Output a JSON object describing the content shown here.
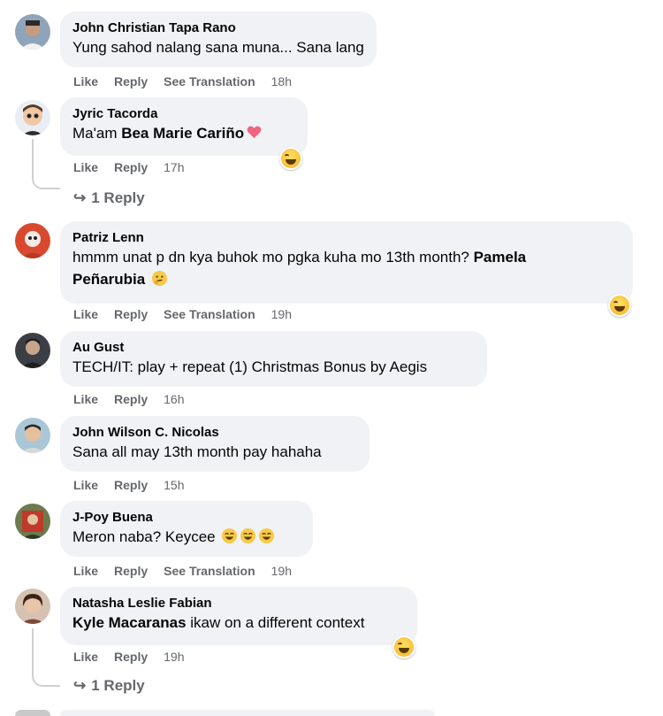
{
  "comments": [
    {
      "author": "John Christian Tapa Rano",
      "text": "Yung sahod nalang sana muna... Sana lang",
      "like": "Like",
      "reply": "Reply",
      "translate": "See Translation",
      "time": "18h"
    },
    {
      "author": "Jyric Tacorda",
      "prefix": "Ma'am ",
      "mention": "Bea Marie Cariño",
      "like": "Like",
      "reply": "Reply",
      "time": "17h",
      "replies": "1 Reply"
    },
    {
      "author": "Patriz Lenn",
      "text1": "hmmm unat p dn kya buhok mo pgka kuha mo 13th month? ",
      "mention_a": "Pamela",
      "mention_b": "Peñarubia",
      "like": "Like",
      "reply": "Reply",
      "translate": "See Translation",
      "time": "19h"
    },
    {
      "author": "Au Gust",
      "text": "TECH/IT: play + repeat (1) Christmas Bonus by Aegis",
      "like": "Like",
      "reply": "Reply",
      "time": "16h"
    },
    {
      "author": "John Wilson C. Nicolas",
      "text": "Sana all may 13th month pay hahaha",
      "like": "Like",
      "reply": "Reply",
      "time": "15h"
    },
    {
      "author": "J-Poy Buena",
      "text": "Meron naba? Keycee ",
      "like": "Like",
      "reply": "Reply",
      "translate": "See Translation",
      "time": "19h"
    },
    {
      "author": "Natasha Leslie Fabian",
      "mention": "Kyle Macaranas",
      "text": " ikaw on a different context",
      "like": "Like",
      "reply": "Reply",
      "time": "19h",
      "replies": "1 Reply"
    }
  ],
  "colors": {
    "bubble": "#f0f2f5",
    "meta": "#65676b",
    "text": "#050505"
  },
  "icons": [
    "laughing-reaction-icon",
    "heart-emoji-icon",
    "thinking-emoji-icon",
    "reply-arrow-icon"
  ]
}
